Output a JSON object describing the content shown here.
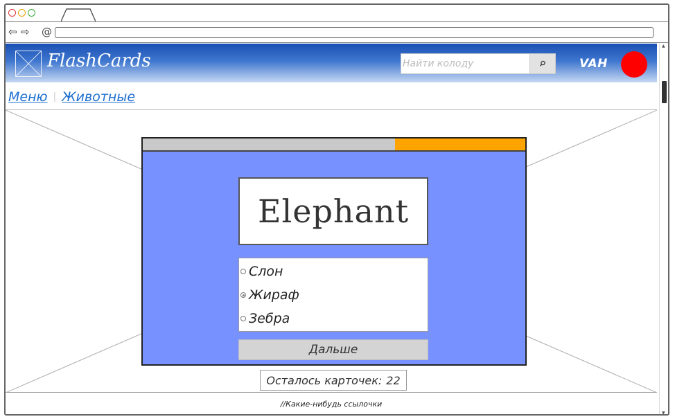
{
  "browser": {
    "back_glyph": "⇦",
    "forward_glyph": "⇨",
    "url_glyph": "@",
    "url": ""
  },
  "header": {
    "title": "FlashCards",
    "search_placeholder": "Найти колоду",
    "search_icon": "search-icon",
    "user_name": "VAH",
    "avatar_color": "#ff0000",
    "gradient_top": "#1a4fb3"
  },
  "breadcrumb": {
    "items": [
      "Меню",
      "Животные"
    ],
    "separator": "|"
  },
  "card": {
    "progress_fraction": 0.34,
    "progress_color": "#ffa300",
    "background_color": "#7791ff",
    "word": "Elephant",
    "options": [
      {
        "label": "Слон",
        "selected": false
      },
      {
        "label": "Жираф",
        "selected": true
      },
      {
        "label": "Зебра",
        "selected": false
      }
    ],
    "next_label": "Дальше"
  },
  "remaining": {
    "label": "Осталось карточек:",
    "count": "22"
  },
  "footer": {
    "text": "//Какие-нибудь ссылочки"
  }
}
